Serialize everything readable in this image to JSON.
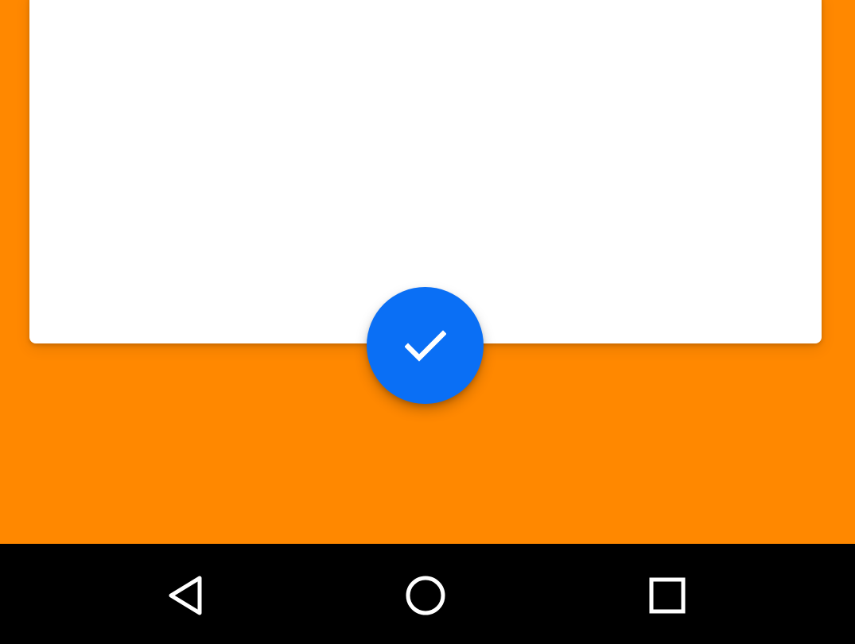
{
  "colors": {
    "background": "#FF8800",
    "card": "#FFFFFF",
    "fab": "#0A6FF5",
    "fab_icon": "#FFFFFF",
    "nav_bar": "#000000",
    "nav_icon": "#FFFFFF"
  },
  "fab": {
    "icon": "check-icon"
  },
  "navigation_bar": {
    "buttons": [
      {
        "icon": "back-triangle-icon"
      },
      {
        "icon": "home-circle-icon"
      },
      {
        "icon": "recents-square-icon"
      }
    ]
  }
}
